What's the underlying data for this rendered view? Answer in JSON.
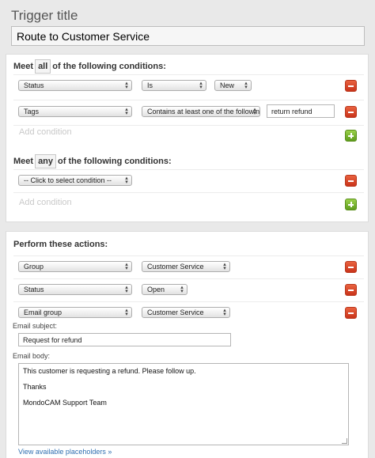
{
  "trigger": {
    "title_label": "Trigger title",
    "title_value": "Route to Customer Service"
  },
  "conditions_all": {
    "prefix": "Meet",
    "qualifier": "all",
    "suffix": "of the following conditions:",
    "rows": [
      {
        "field": "Status",
        "operator": "Is",
        "value": "New"
      },
      {
        "field": "Tags",
        "operator": "Contains at least one of the following",
        "value": "return refund"
      }
    ],
    "add_label": "Add condition"
  },
  "conditions_any": {
    "prefix": "Meet",
    "qualifier": "any",
    "suffix": "of the following conditions:",
    "rows": [
      {
        "field": "-- Click to select condition --"
      }
    ],
    "add_label": "Add condition"
  },
  "actions": {
    "heading": "Perform these actions:",
    "rows": [
      {
        "field": "Group",
        "value": "Customer Service"
      },
      {
        "field": "Status",
        "value": "Open"
      },
      {
        "field": "Email group",
        "value": "Customer Service"
      }
    ],
    "email_subject_label": "Email subject:",
    "email_subject_value": "Request for refund",
    "email_body_label": "Email body:",
    "email_body_lines": [
      "This customer is requesting a refund. Please follow up.",
      "Thanks",
      "MondoCAM Support Team"
    ],
    "placeholders_link": "View available placeholders »"
  },
  "colors": {
    "remove_button": "#d9482a",
    "add_button": "#7cb82f",
    "link": "#2f6fb0"
  }
}
